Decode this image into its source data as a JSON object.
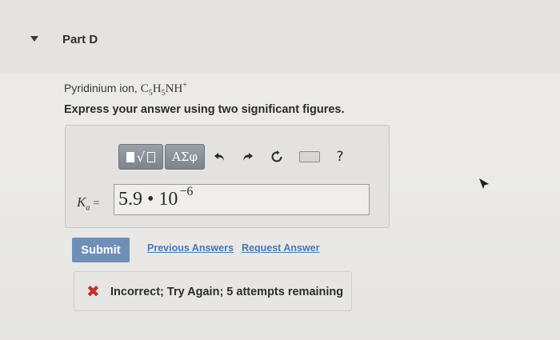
{
  "part": {
    "title": "Part D",
    "expanded": true
  },
  "question": {
    "prefix": "Pyridinium ion, ",
    "formula": {
      "c": "C",
      "c_sub": "5",
      "h": "H",
      "h_sub": "5",
      "nh": "NH",
      "charge": "+"
    }
  },
  "instructions": "Express your answer using two significant figures.",
  "toolbar": {
    "templates_icon": "template-icon",
    "templates_label": "√",
    "greek_label": "ΑΣφ",
    "undo_icon": "undo-icon",
    "redo_icon": "redo-icon",
    "reset_icon": "reset-icon",
    "keyboard_icon": "keyboard-icon",
    "help_label": "?"
  },
  "answer": {
    "label_var": "K",
    "label_sub": "a",
    "label_eq": "=",
    "mantissa": "5.9",
    "times": " • ",
    "base": "10",
    "exponent": "−6"
  },
  "actions": {
    "submit_label": "Submit",
    "previous_answers_label": "Previous Answers",
    "request_answer_label": "Request Answer"
  },
  "feedback": {
    "icon": "x-icon",
    "symbol": "✖",
    "text": "Incorrect; Try Again; 5 attempts remaining",
    "color": "#c4312b"
  },
  "colors": {
    "submit": "#6f8fb8",
    "link": "#4b78b3",
    "toolbar_button": "#8a9198"
  }
}
